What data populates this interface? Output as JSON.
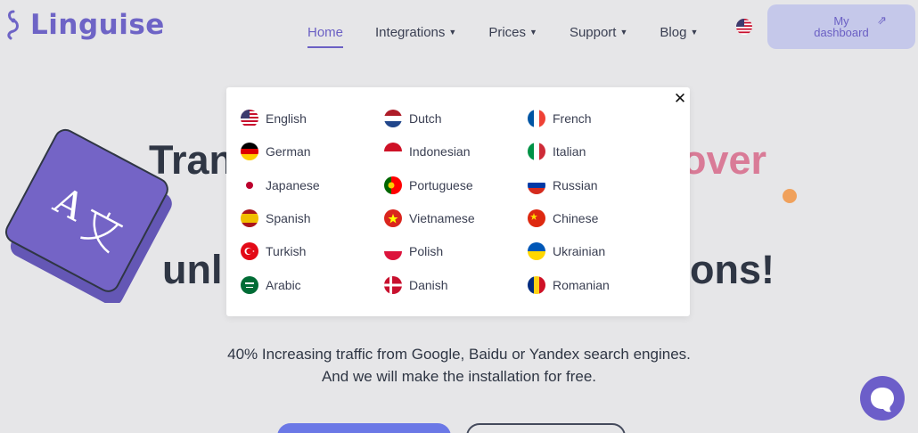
{
  "brand": {
    "name": "Linguise"
  },
  "nav": {
    "items": [
      {
        "label": "Home",
        "active": true
      },
      {
        "label": "Integrations",
        "dropdown": true
      },
      {
        "label": "Prices",
        "dropdown": true
      },
      {
        "label": "Support",
        "dropdown": true
      },
      {
        "label": "Blog",
        "dropdown": true
      }
    ],
    "current_flag": "us-flag-icon",
    "dashboard_label_line1": "My",
    "dashboard_label_line2": "dashboard"
  },
  "hero": {
    "title_part1": "Tran",
    "title_part2": "over",
    "title_part3": "unl",
    "title_part4": "ons!",
    "subtitle_line1": "40% Increasing traffic from Google, Baidu or Yandex search engines.",
    "subtitle_line2": "And we will make the installation for free."
  },
  "language_modal": {
    "close_icon": "close-icon",
    "languages": [
      {
        "label": "English",
        "flag": "us"
      },
      {
        "label": "Dutch",
        "flag": "nl"
      },
      {
        "label": "French",
        "flag": "fr"
      },
      {
        "label": "German",
        "flag": "de"
      },
      {
        "label": "Indonesian",
        "flag": "id"
      },
      {
        "label": "Italian",
        "flag": "it"
      },
      {
        "label": "Japanese",
        "flag": "jp"
      },
      {
        "label": "Portuguese",
        "flag": "pt"
      },
      {
        "label": "Russian",
        "flag": "ru"
      },
      {
        "label": "Spanish",
        "flag": "es"
      },
      {
        "label": "Vietnamese",
        "flag": "vn"
      },
      {
        "label": "Chinese",
        "flag": "cn"
      },
      {
        "label": "Turkish",
        "flag": "tr"
      },
      {
        "label": "Polish",
        "flag": "pl"
      },
      {
        "label": "Ukrainian",
        "flag": "ua"
      },
      {
        "label": "Arabic",
        "flag": "sa"
      },
      {
        "label": "Danish",
        "flag": "dk"
      },
      {
        "label": "Romanian",
        "flag": "ro"
      }
    ]
  },
  "colors": {
    "accent": "#6b60c4",
    "background": "#e6e6e8",
    "highlight": "#d97b97"
  }
}
